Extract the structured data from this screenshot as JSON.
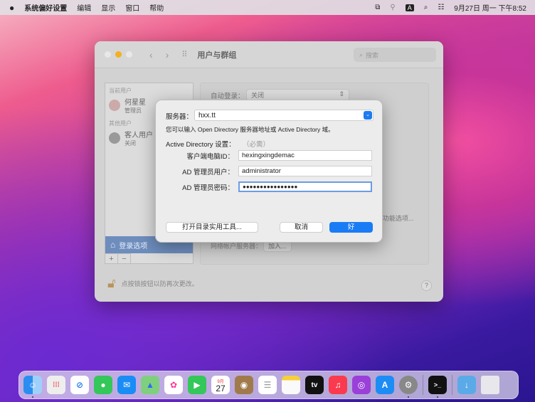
{
  "menubar": {
    "app": "系统偏好设置",
    "items": [
      "编辑",
      "显示",
      "窗口",
      "帮助"
    ],
    "input_badge": "A",
    "clock": "9月27日 周一 下午8:52"
  },
  "window": {
    "title": "用户与群组",
    "search_placeholder": "搜索",
    "sidebar": {
      "current_header": "当前用户",
      "current_user": {
        "name": "何星星",
        "role": "管理员"
      },
      "other_header": "其他用户",
      "guest": {
        "name": "客人用户",
        "status": "关闭"
      },
      "login_options": "登录选项",
      "add": "+",
      "remove": "−"
    },
    "panel": {
      "auto_login_label": "自动登录：",
      "auto_login_value": "关闭",
      "accessibility_btn": "功能选项...",
      "network_label": "网络帐户服务器：",
      "join_btn": "加入..."
    },
    "lock_text": "点按锁按钮以防再次更改。",
    "help": "?"
  },
  "dialog": {
    "server_label": "服务器：",
    "server_value": "hxx.tt",
    "hint": "您可以输入 Open Directory 服务器地址或 Active Directory 域。",
    "ad_label": "Active Directory 设置：",
    "required": "（必需）",
    "fields": [
      {
        "label": "客户端电脑ID：",
        "value": "hexingxingdemac"
      },
      {
        "label": "AD 管理员用户：",
        "value": "administrator"
      },
      {
        "label": "AD 管理员密码：",
        "value": "●●●●●●●●●●●●●●●●"
      }
    ],
    "open_utility": "打开目录实用工具...",
    "cancel": "取消",
    "ok": "好"
  },
  "dock": {
    "calendar_month": "9月",
    "calendar_day": "27",
    "tv": "tv",
    "terminal": ">_"
  }
}
